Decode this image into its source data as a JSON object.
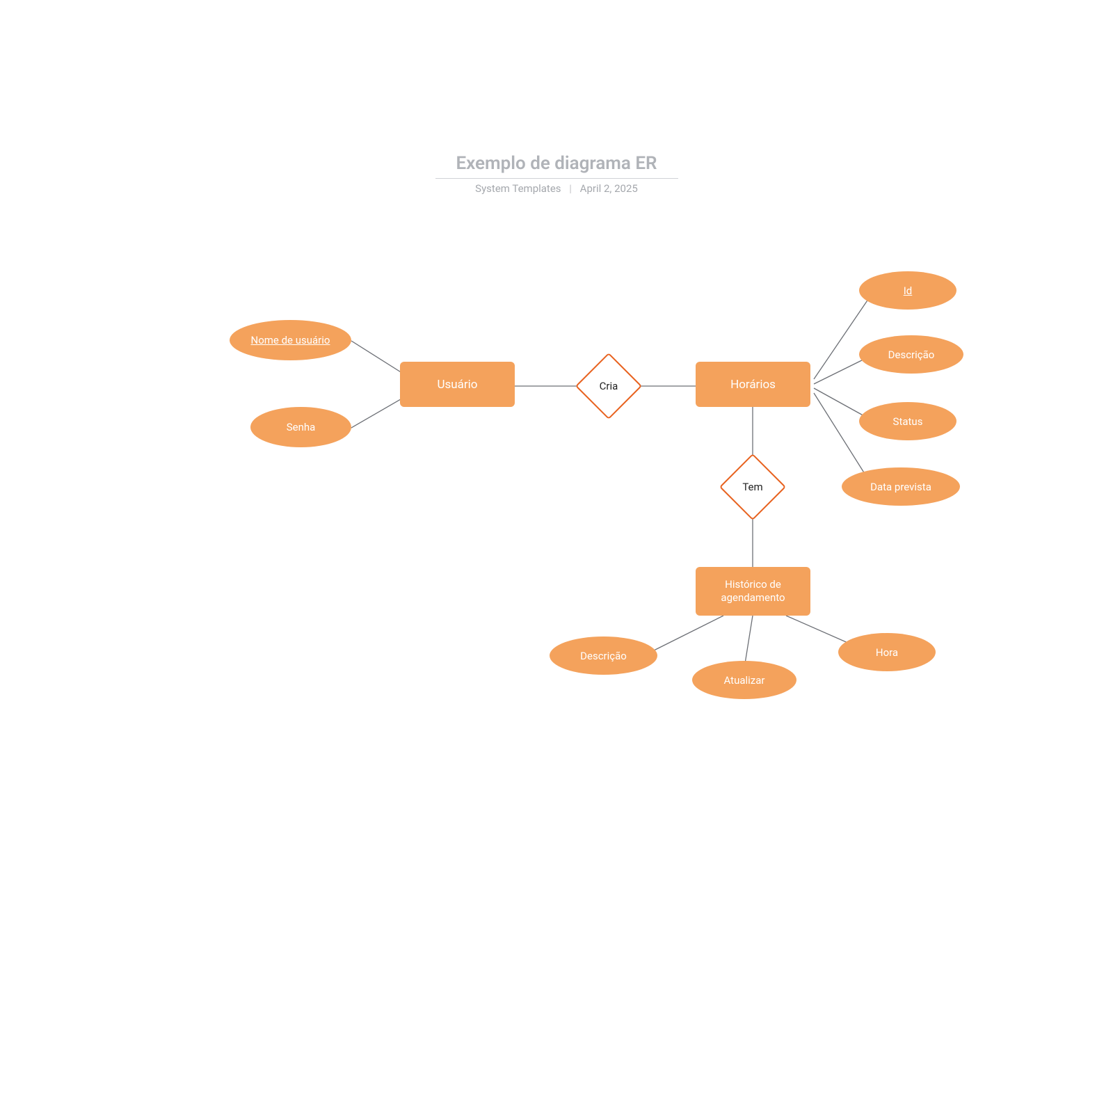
{
  "header": {
    "title": "Exemplo de diagrama ER",
    "subtitle_left": "System Templates",
    "subtitle_right": "April 2, 2025"
  },
  "entities": {
    "usuario": "Usuário",
    "horarios": "Horários",
    "historico": "Histórico de agendamento"
  },
  "relationships": {
    "cria": "Cria",
    "tem": "Tem"
  },
  "attributes": {
    "usuario_nome": "Nome de usuário",
    "usuario_senha": "Senha",
    "horarios_id": "Id",
    "horarios_descricao": "Descrição",
    "horarios_status": "Status",
    "horarios_data": "Data prevista",
    "hist_descricao": "Descrição",
    "hist_atualizar": "Atualizar",
    "hist_hora": "Hora"
  },
  "colors": {
    "shape_fill": "#f4a25c",
    "relationship_border": "#e8621f",
    "header_text": "#b0b3b8"
  }
}
